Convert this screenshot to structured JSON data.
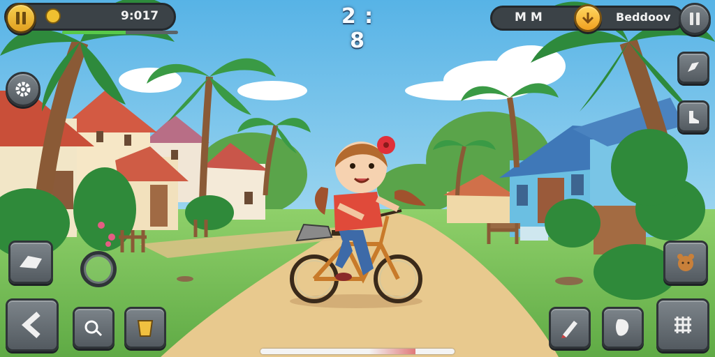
{
  "hud": {
    "time_display": "9:017",
    "timer": "2 : 8",
    "player_name": "M M",
    "score_text": "Beddoov",
    "health_fraction": 0.55,
    "progress_fraction": 0.8
  },
  "controls": {
    "left_top": [
      "pause",
      "settings"
    ],
    "right_top": [
      "pause",
      "ability-1",
      "ability-2"
    ],
    "bottom_left": [
      "skate",
      "joystick-ring",
      "back",
      "tool",
      "bucket"
    ],
    "bottom_right": [
      "animal",
      "pen",
      "mask",
      "pattern"
    ]
  },
  "colors": {
    "sky_top": "#5fb9e8",
    "sky_bottom": "#bfe6f5",
    "grass": "#7cc25a",
    "path": "#e8c98e",
    "button": "#6a7177",
    "accent_gold": "#f0b43a"
  }
}
